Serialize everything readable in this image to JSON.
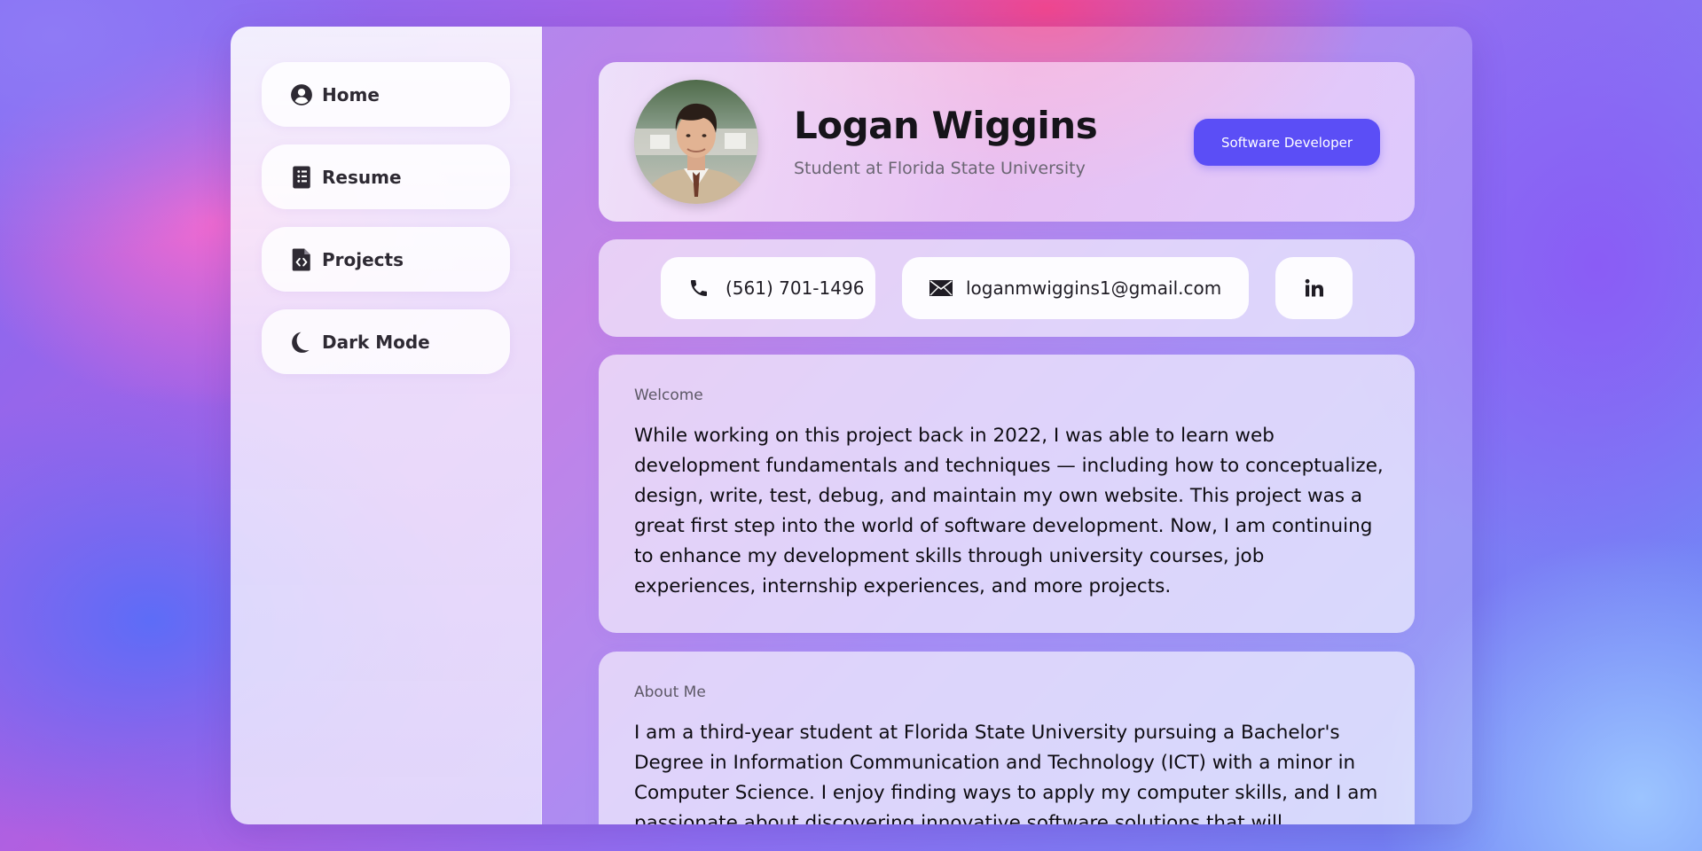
{
  "sidebar": {
    "items": [
      {
        "label": "Home",
        "icon": "user-circle-icon"
      },
      {
        "label": "Resume",
        "icon": "document-icon"
      },
      {
        "label": "Projects",
        "icon": "code-file-icon"
      },
      {
        "label": "Dark Mode",
        "icon": "moon-icon"
      }
    ]
  },
  "profile": {
    "name": "Logan Wiggins",
    "subtitle": "Student at Florida State University",
    "role_button": "Software Developer",
    "accent_color": "#5b4ef6"
  },
  "contacts": {
    "phone": "(561) 701-1496",
    "email": "loganmwiggins1@gmail.com",
    "linkedin_icon": "linkedin-icon"
  },
  "sections": {
    "welcome": {
      "label": "Welcome",
      "body": "While working on this project back in 2022, I was able to learn web development fundamentals and techniques — including how to conceptualize, design, write, test, debug, and maintain my own website. This project was a great first step into the world of software development. Now, I am continuing to enhance my development skills through university courses, job experiences, internship experiences, and more projects."
    },
    "about": {
      "label": "About Me",
      "body": "I am a third-year student at Florida State University pursuing a Bachelor's Degree in Information Communication and Technology (ICT) with a minor in Computer Science. I enjoy finding ways to apply my computer skills, and I am passionate about discovering innovative software solutions that will"
    }
  }
}
